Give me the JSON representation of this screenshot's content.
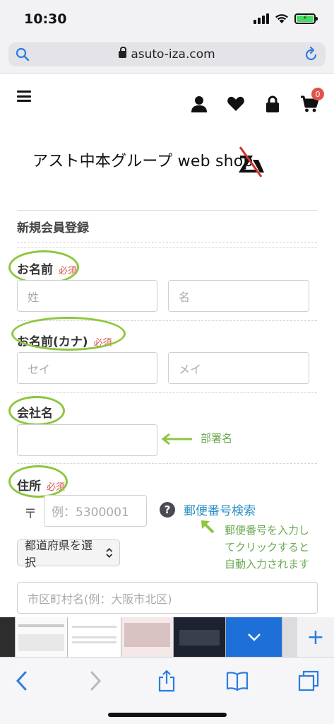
{
  "status": {
    "time": "10:30"
  },
  "browser": {
    "url": "asuto-iza.com"
  },
  "header": {
    "cart_count": "0"
  },
  "logo": {
    "text": "アスト中本グループ web shop"
  },
  "form": {
    "title": "新規会員登録",
    "required": "必須",
    "name": {
      "label": "お名前",
      "last_placeholder": "姓",
      "first_placeholder": "名"
    },
    "kana": {
      "label": "お名前(カナ)",
      "last_placeholder": "セイ",
      "first_placeholder": "メイ"
    },
    "company": {
      "label": "会社名",
      "value": ""
    },
    "address": {
      "label": "住所",
      "zip_symbol": "〒",
      "zip_placeholder": "例：5300001",
      "zip_search": "郵便番号検索",
      "prefecture": "都道府県を選択",
      "city_placeholder": "市区町村名(例：大阪市北区)"
    }
  },
  "annotations": {
    "dept_note": "部署名",
    "zip_note_1": "郵便番号を入力し",
    "zip_note_2": "てクリックすると",
    "zip_note_3": "自動入力されます"
  },
  "colors": {
    "highlight": "#8dc63f",
    "link": "#2a8fc5",
    "required": "#d9534f",
    "badge": "#e0544a"
  }
}
